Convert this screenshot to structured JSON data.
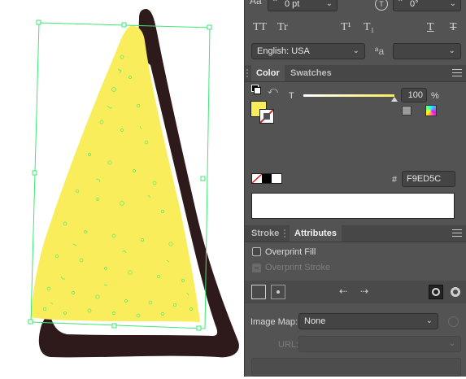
{
  "character": {
    "tracking_value": "0 pt",
    "rotation_value": "0°",
    "language": "English: USA",
    "style_buttons": [
      "TT",
      "Tr",
      "T¹",
      "T₁",
      "T",
      "T"
    ]
  },
  "color_panel": {
    "tabs": [
      "Color",
      "Swatches"
    ],
    "active_tab": "Color",
    "channel_label": "T",
    "tint_value": "100",
    "tint_unit": "%",
    "tint_level": 1.0,
    "hex_prefix": "#",
    "hex_value": "F9ED5C",
    "fill_color": "#F9ED5C"
  },
  "attributes_panel": {
    "tabs": [
      "Stroke",
      "Attributes"
    ],
    "active_tab": "Attributes",
    "overprint_fill": "Overprint Fill",
    "overprint_stroke": "Overprint Stroke",
    "image_map_label": "Image Map:",
    "image_map_value": "None",
    "url_label": "URL:"
  },
  "artwork": {
    "fill_color": "#F9ED5C",
    "stroke_color": "#2E1A1A",
    "selection_color": "#3CE870"
  }
}
